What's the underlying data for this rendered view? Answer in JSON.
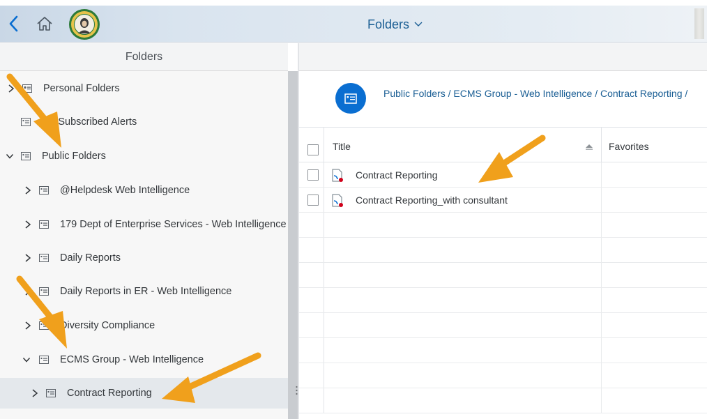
{
  "header": {
    "title": "Folders",
    "icons": [
      "back-chevron-icon",
      "home-icon",
      "state-seal-logo",
      "chevron-down-icon"
    ]
  },
  "left_pane": {
    "title": "Folders",
    "tree": [
      {
        "label": "Personal Folders",
        "expanded": false,
        "selected": false
      },
      {
        "label": "My Subscribed Alerts",
        "expanded": null,
        "selected": false
      },
      {
        "label": "Public Folders",
        "expanded": true,
        "selected": false
      },
      {
        "label": "@Helpdesk Web Intelligence",
        "expanded": false,
        "selected": false
      },
      {
        "label": "179 Dept of Enterprise Services - Web Intelligence",
        "expanded": false,
        "selected": false
      },
      {
        "label": "Daily Reports",
        "expanded": false,
        "selected": false
      },
      {
        "label": "Daily Reports in ER - Web Intelligence",
        "expanded": false,
        "selected": false
      },
      {
        "label": "Diversity Compliance",
        "expanded": false,
        "selected": false
      },
      {
        "label": "ECMS Group - Web Intelligence",
        "expanded": true,
        "selected": false
      },
      {
        "label": "Contract Reporting",
        "expanded": false,
        "selected": true
      }
    ]
  },
  "breadcrumb": {
    "path": "Public Folders / ECMS Group - Web Intelligence / Contract Reporting /"
  },
  "table": {
    "columns": [
      "Title",
      "Favorites"
    ],
    "rows": [
      {
        "title": "Contract Reporting"
      },
      {
        "title": "Contract Reporting_with consultant"
      }
    ]
  },
  "colors": {
    "accent": "#0a6ed1",
    "link": "#1a5e94",
    "annotation_arrow": "#f0a01c",
    "doc_badge": "#d0021b"
  }
}
